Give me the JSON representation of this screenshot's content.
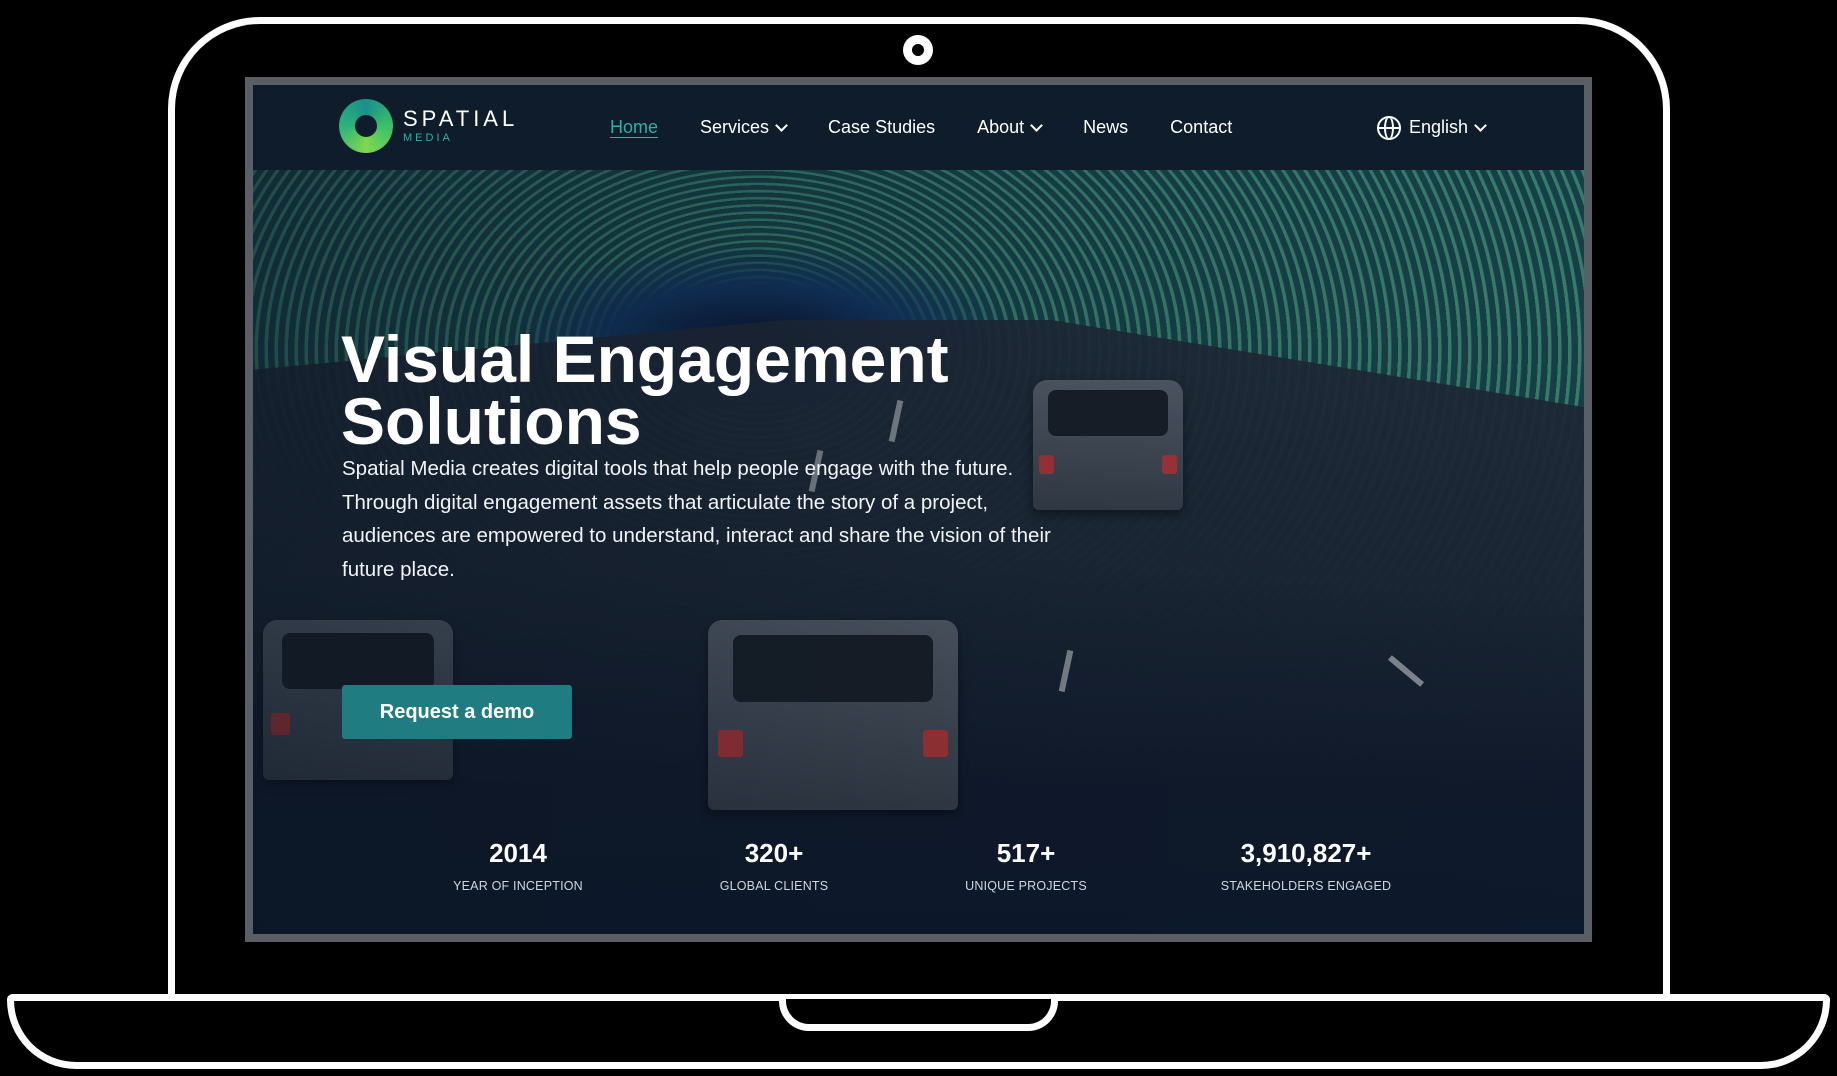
{
  "brand": {
    "name": "SPATIAL",
    "sub": "MEDIA"
  },
  "nav": {
    "items": [
      {
        "label": "Home",
        "active": true
      },
      {
        "label": "Services",
        "dropdown": true
      },
      {
        "label": "Case Studies"
      },
      {
        "label": "About",
        "dropdown": true
      },
      {
        "label": "News"
      },
      {
        "label": "Contact"
      }
    ],
    "language": "English"
  },
  "hero": {
    "title_line1": "Visual Engagement",
    "title_line2": "Solutions",
    "description": "Spatial Media creates digital tools that help people engage with the future. Through digital engagement assets that articulate the story of a project, audiences are empowered to understand, interact and share the vision of their future place.",
    "cta_label": "Request a demo"
  },
  "stats": [
    {
      "value": "2014",
      "label": "YEAR OF INCEPTION"
    },
    {
      "value": "320+",
      "label": "GLOBAL CLIENTS"
    },
    {
      "value": "517+",
      "label": "UNIQUE PROJECTS"
    },
    {
      "value": "3,910,827+",
      "label": "STAKEHOLDERS ENGAGED"
    }
  ],
  "colors": {
    "accent": "#2fb3a0",
    "button": "#1f7c80",
    "nav_bg": "#0e1c2c"
  },
  "icons": {
    "logo": "spatial-media-logo-ring",
    "language": "globe-icon",
    "dropdown": "chevron-down-icon"
  }
}
